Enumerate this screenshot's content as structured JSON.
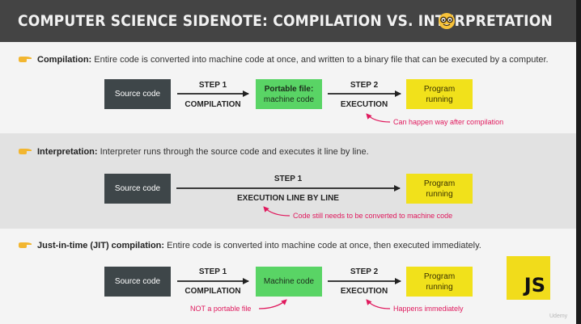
{
  "header": {
    "title": "COMPUTER SCIENCE SIDENOTE: COMPILATION VS. INTERPRETATION"
  },
  "compilation": {
    "term": "Compilation:",
    "description": " Entire code is converted into machine code at once, and written to a binary file that can be executed by a computer.",
    "source_label": "Source code",
    "step1_title": "STEP 1",
    "step1_sub": "COMPILATION",
    "portable_line1": "Portable file:",
    "portable_line2": "machine code",
    "step2_title": "STEP 2",
    "step2_sub": "EXECUTION",
    "program_label": "Program running",
    "note": "Can happen way after compilation"
  },
  "interpretation": {
    "term": "Interpretation:",
    "description": " Interpreter runs through the source code and executes it line by line.",
    "source_label": "Source code",
    "step1_title": "STEP 1",
    "step1_sub": "EXECUTION LINE BY LINE",
    "program_label": "Program running",
    "note": "Code still needs to be converted to machine code"
  },
  "jit": {
    "term": "Just-in-time (JIT) compilation:",
    "description": " Entire code is converted into machine code at once, then executed immediately.",
    "source_label": "Source code",
    "step1_title": "STEP 1",
    "step1_sub": "COMPILATION",
    "machine_label": "Machine code",
    "step2_title": "STEP 2",
    "step2_sub": "EXECUTION",
    "program_label": "Program running",
    "note_left": "NOT a portable file",
    "note_right": "Happens immediately",
    "js_logo": "JS"
  },
  "watermark": "Udemy",
  "colors": {
    "header": "#444444",
    "dark_box": "#3e4649",
    "green_box": "#59d465",
    "yellow_box": "#f1e11b",
    "note": "#e0195d",
    "js_yellow": "#f1dc1b"
  },
  "icons": {
    "title_emoji": "nerd-face-icon",
    "bullet": "pointing-hand-icon"
  }
}
